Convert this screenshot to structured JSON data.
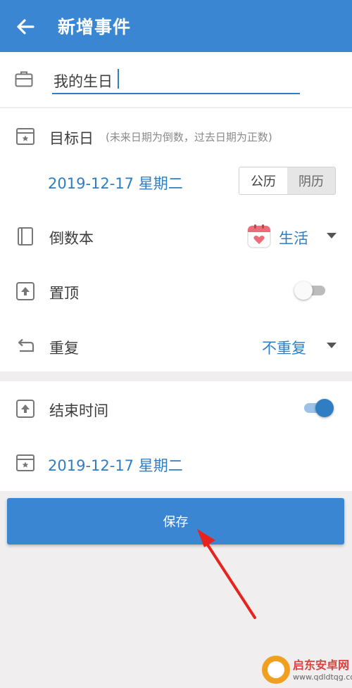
{
  "appbar": {
    "title": "新增事件",
    "back_icon": "arrow-left-icon"
  },
  "event": {
    "name": "我的生日"
  },
  "target_date": {
    "label": "目标日",
    "hint": "(未来日期为倒数，过去日期为正数)",
    "date": "2019-12-17 星期二",
    "calendar_options": [
      "公历",
      "阴历"
    ],
    "selected_calendar": "公历"
  },
  "book": {
    "label": "倒数本",
    "value": "生活",
    "icon": "calendar-heart-icon"
  },
  "pin": {
    "label": "置顶",
    "enabled": false
  },
  "repeat": {
    "label": "重复",
    "value": "不重复"
  },
  "end_time": {
    "label": "结束时间",
    "enabled": true,
    "date": "2019-12-17 星期二"
  },
  "save_label": "保存",
  "watermark": {
    "name": "启东安卓网",
    "url": "www.qdldtqg.com"
  },
  "colors": {
    "primary": "#3b86d2",
    "accent_text": "#2f7ec4",
    "annotation_arrow": "#e8231e"
  }
}
